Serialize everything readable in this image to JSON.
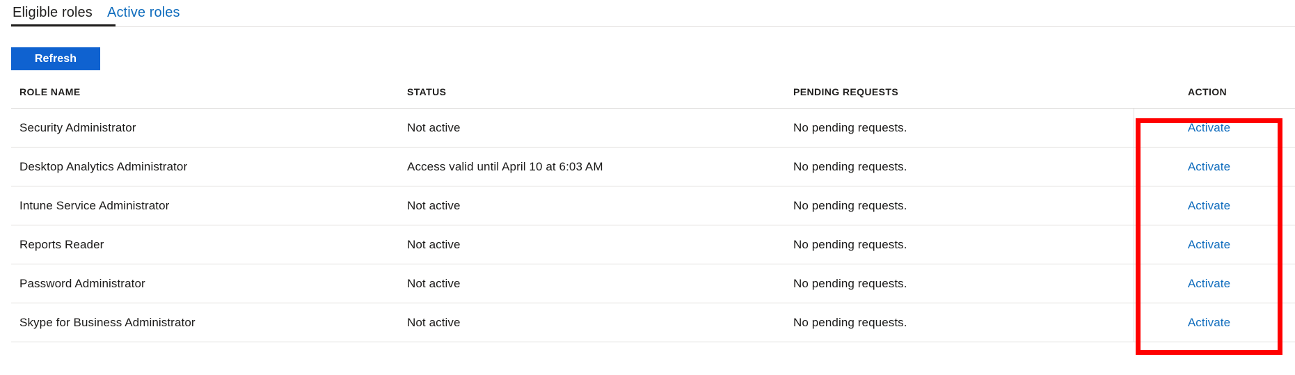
{
  "tabs": [
    {
      "label": "Eligible roles",
      "selected": true
    },
    {
      "label": "Active roles",
      "selected": false
    }
  ],
  "toolbar": {
    "refresh_label": "Refresh"
  },
  "table": {
    "columns": [
      "ROLE NAME",
      "STATUS",
      "PENDING REQUESTS",
      "ACTION"
    ],
    "rows": [
      {
        "role": "Security Administrator",
        "status": "Not active",
        "pending": "No pending requests.",
        "action": "Activate"
      },
      {
        "role": "Desktop Analytics Administrator",
        "status": "Access valid until April 10 at 6:03 AM",
        "pending": "No pending requests.",
        "action": "Activate"
      },
      {
        "role": "Intune Service Administrator",
        "status": "Not active",
        "pending": "No pending requests.",
        "action": "Activate"
      },
      {
        "role": "Reports Reader",
        "status": "Not active",
        "pending": "No pending requests.",
        "action": "Activate"
      },
      {
        "role": "Password Administrator",
        "status": "Not active",
        "pending": "No pending requests.",
        "action": "Activate"
      },
      {
        "role": "Skype for Business Administrator",
        "status": "Not active",
        "pending": "No pending requests.",
        "action": "Activate"
      }
    ]
  },
  "colors": {
    "accent": "#0f62d0",
    "link": "#0f6cbd",
    "annotation": "#ff0000",
    "divider": "#e1dfdd",
    "text": "#201f1e"
  }
}
